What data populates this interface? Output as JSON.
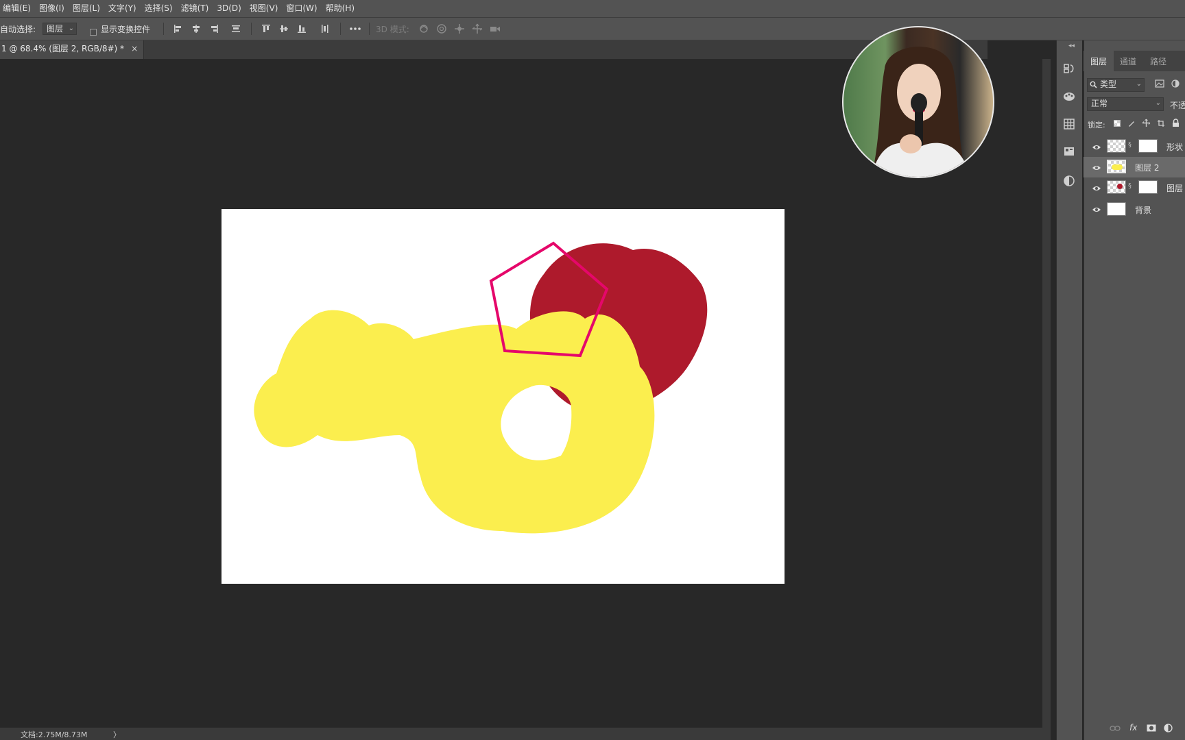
{
  "menu": [
    "编辑(E)",
    "图像(I)",
    "图层(L)",
    "文字(Y)",
    "选择(S)",
    "滤镜(T)",
    "3D(D)",
    "视图(V)",
    "窗口(W)",
    "帮助(H)"
  ],
  "options": {
    "auto_select_label": "自动选择:",
    "auto_select_value": "图层",
    "show_transform_label": "显示变换控件",
    "mode_3d_label": "3D 模式:"
  },
  "document_tab": {
    "title": "1 @ 68.4% (图层 2, RGB/8#) *",
    "close": "×"
  },
  "panel": {
    "tabs": [
      "图层",
      "通道",
      "路径"
    ],
    "filter_value": "类型",
    "blend_mode": "正常",
    "opacity_label": "不透",
    "lock_label": "锁定:",
    "layers": [
      {
        "name": "形状",
        "thumb": "shape",
        "has_mask": true
      },
      {
        "name": "图层 2",
        "thumb": "yellow",
        "has_mask": false,
        "selected": true
      },
      {
        "name": "图层",
        "thumb": "red",
        "has_mask": true
      },
      {
        "name": "背景",
        "thumb": "white",
        "has_mask": false
      }
    ]
  },
  "status": {
    "doc_size": "文档:2.75M/8.73M",
    "arrow": "〉"
  },
  "colors": {
    "yellow_paint": "#fbee4e",
    "red_paint": "#ae1a2c",
    "pentagon_stroke": "#e5076a"
  }
}
